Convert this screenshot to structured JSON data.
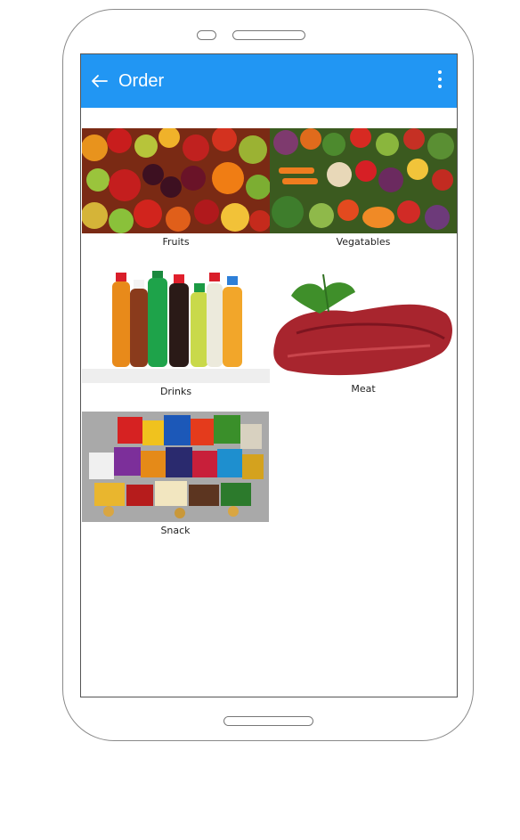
{
  "app": {
    "title": "Order"
  },
  "icons": {
    "back": "arrow-left-icon",
    "menu": "more-vert-icon"
  },
  "colors": {
    "appbar": "#2196f3",
    "title_text": "#ffffff"
  },
  "categories": [
    {
      "label": "Fruits",
      "image": "fruits-photo"
    },
    {
      "label": "Vegatables",
      "image": "vegetables-photo"
    },
    {
      "label": "Drinks",
      "image": "drinks-photo"
    },
    {
      "label": "Meat",
      "image": "meat-photo"
    },
    {
      "label": "Snack",
      "image": "snack-photo"
    }
  ]
}
